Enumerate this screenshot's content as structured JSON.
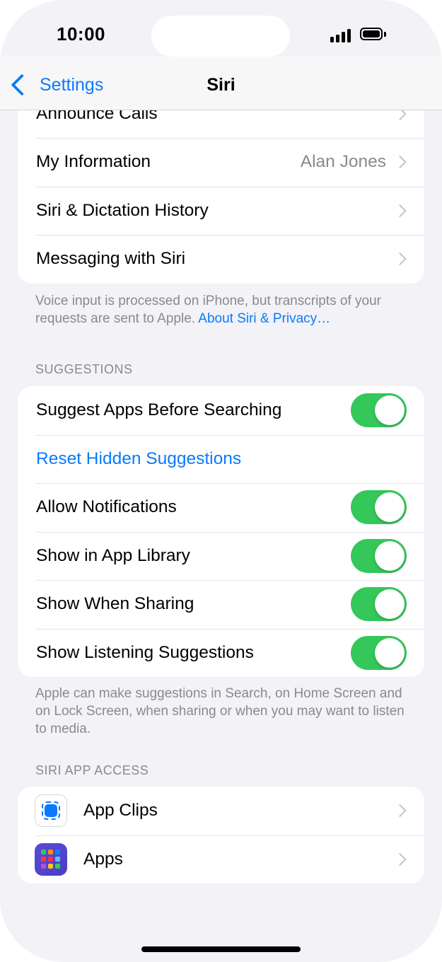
{
  "status": {
    "time": "10:00"
  },
  "nav": {
    "back_label": "Settings",
    "title": "Siri"
  },
  "group1": {
    "rows": [
      {
        "label": "Announce Calls"
      },
      {
        "label": "My Information",
        "value": "Alan Jones"
      },
      {
        "label": "Siri & Dictation History"
      },
      {
        "label": "Messaging with Siri"
      }
    ],
    "footer_text": "Voice input is processed on iPhone, but transcripts of your requests are sent to Apple. ",
    "footer_link": "About Siri & Privacy…"
  },
  "suggestions": {
    "header": "SUGGESTIONS",
    "rows": [
      {
        "label": "Suggest Apps Before Searching",
        "toggle": true
      },
      {
        "label": "Reset Hidden Suggestions"
      },
      {
        "label": "Allow Notifications",
        "toggle": true
      },
      {
        "label": "Show in App Library",
        "toggle": true
      },
      {
        "label": "Show When Sharing",
        "toggle": true
      },
      {
        "label": "Show Listening Suggestions",
        "toggle": true
      }
    ],
    "footer_text": "Apple can make suggestions in Search, on Home Screen and on Lock Screen, when sharing or when you may want to listen to media."
  },
  "app_access": {
    "header": "SIRI APP ACCESS",
    "rows": [
      {
        "label": "App Clips",
        "icon": "app-clips-icon"
      },
      {
        "label": "Apps",
        "icon": "apps-grid-icon"
      }
    ]
  },
  "colors": {
    "accent": "#0a7aff",
    "toggle_on": "#34c759",
    "background": "#f2f2f7"
  }
}
